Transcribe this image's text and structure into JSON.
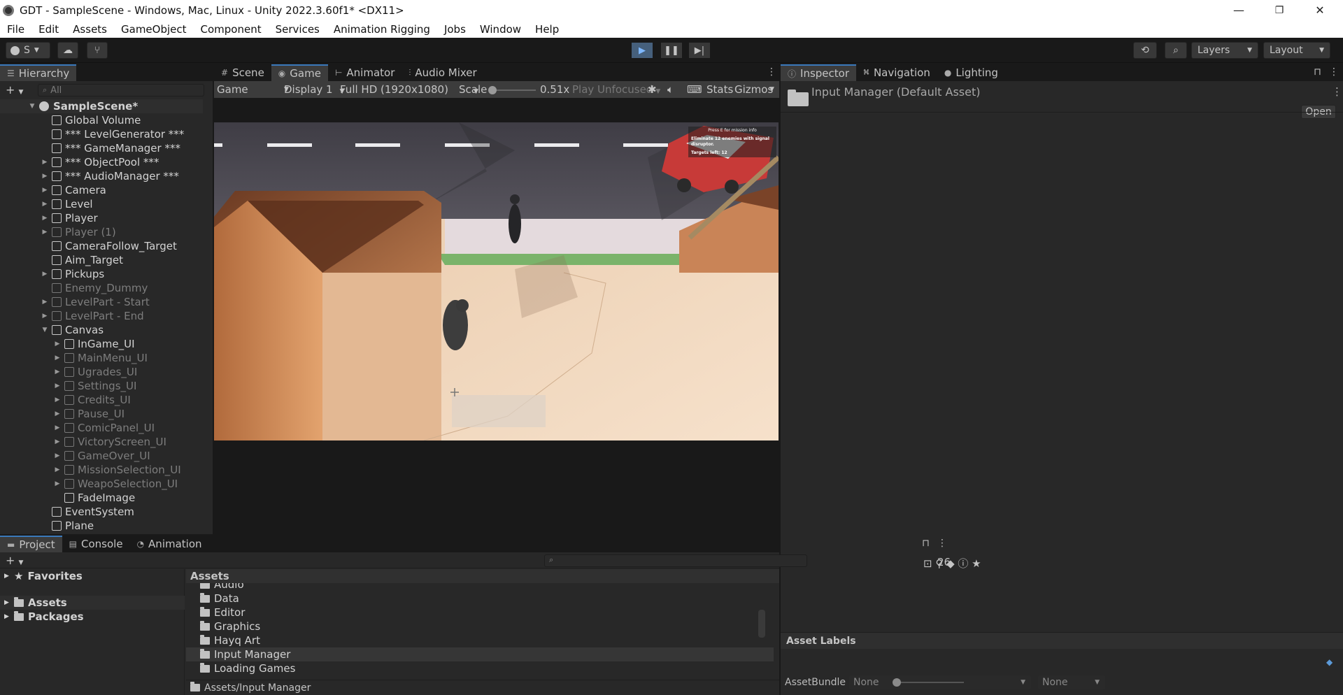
{
  "window": {
    "title": "GDT - SampleScene - Windows, Mac, Linux - Unity 2022.3.60f1* <DX11>",
    "minimize": "—",
    "maximize": "❐",
    "close": "✕"
  },
  "menu": [
    "File",
    "Edit",
    "Assets",
    "GameObject",
    "Component",
    "Services",
    "Animation Rigging",
    "Jobs",
    "Window",
    "Help"
  ],
  "toolbar": {
    "account": "S",
    "layers": "Layers",
    "layout": "Layout"
  },
  "hierarchy": {
    "tab": "Hierarchy",
    "search_placeholder": "All",
    "scene": "SampleScene*",
    "items": [
      {
        "label": "Global Volume",
        "arrow": "",
        "dim": false,
        "indent": 0
      },
      {
        "label": "*** LevelGenerator ***",
        "arrow": "",
        "dim": false,
        "indent": 0
      },
      {
        "label": "*** GameManager ***",
        "arrow": "",
        "dim": false,
        "indent": 0
      },
      {
        "label": "*** ObjectPool ***",
        "arrow": "▶",
        "dim": false,
        "indent": 0
      },
      {
        "label": "*** AudioManager ***",
        "arrow": "▶",
        "dim": false,
        "indent": 0
      },
      {
        "label": "Camera",
        "arrow": "▶",
        "dim": false,
        "indent": 0
      },
      {
        "label": "Level",
        "arrow": "▶",
        "dim": false,
        "indent": 0
      },
      {
        "label": "Player",
        "arrow": "▶",
        "dim": false,
        "indent": 0
      },
      {
        "label": "Player (1)",
        "arrow": "▶",
        "dim": true,
        "indent": 0
      },
      {
        "label": "CameraFollow_Target",
        "arrow": "",
        "dim": false,
        "indent": 0
      },
      {
        "label": "Aim_Target",
        "arrow": "",
        "dim": false,
        "indent": 0
      },
      {
        "label": "Pickups",
        "arrow": "▶",
        "dim": false,
        "indent": 0
      },
      {
        "label": "Enemy_Dummy",
        "arrow": "",
        "dim": true,
        "indent": 0
      },
      {
        "label": "LevelPart - Start",
        "arrow": "▶",
        "dim": true,
        "indent": 0
      },
      {
        "label": "LevelPart - End",
        "arrow": "▶",
        "dim": true,
        "indent": 0
      },
      {
        "label": "Canvas",
        "arrow": "▼",
        "dim": false,
        "indent": 0
      },
      {
        "label": "InGame_UI",
        "arrow": "▶",
        "dim": false,
        "indent": 1
      },
      {
        "label": "MainMenu_UI",
        "arrow": "▶",
        "dim": true,
        "indent": 1
      },
      {
        "label": "Ugrades_UI",
        "arrow": "▶",
        "dim": true,
        "indent": 1
      },
      {
        "label": "Settings_UI",
        "arrow": "▶",
        "dim": true,
        "indent": 1
      },
      {
        "label": "Credits_UI",
        "arrow": "▶",
        "dim": true,
        "indent": 1
      },
      {
        "label": "Pause_UI",
        "arrow": "▶",
        "dim": true,
        "indent": 1
      },
      {
        "label": "ComicPanel_UI",
        "arrow": "▶",
        "dim": true,
        "indent": 1
      },
      {
        "label": "VictoryScreen_UI",
        "arrow": "▶",
        "dim": true,
        "indent": 1
      },
      {
        "label": "GameOver_UI",
        "arrow": "▶",
        "dim": true,
        "indent": 1
      },
      {
        "label": "MissionSelection_UI",
        "arrow": "▶",
        "dim": true,
        "indent": 1
      },
      {
        "label": "WeapoSelection_UI",
        "arrow": "▶",
        "dim": true,
        "indent": 1
      },
      {
        "label": "FadeImage",
        "arrow": "",
        "dim": false,
        "indent": 1
      },
      {
        "label": "EventSystem",
        "arrow": "",
        "dim": false,
        "indent": 0
      },
      {
        "label": "Plane",
        "arrow": "",
        "dim": false,
        "indent": 0
      }
    ]
  },
  "center_tabs": [
    "Scene",
    "Game",
    "Animator",
    "Audio Mixer"
  ],
  "game": {
    "mode": "Game",
    "display": "Display 1",
    "resolution": "Full HD (1920x1080)",
    "scale_label": "Scale",
    "scale_value": "0.51x",
    "play_mode": "Play Unfocused",
    "stats": "Stats",
    "gizmos": "Gizmos",
    "hud_hint": "Press E for mission info",
    "hud_mission": "Eliminate 12 enemies with signal disruptor.",
    "hud_targets": "Targets left: 12"
  },
  "inspector": {
    "tabs": [
      "Inspector",
      "Navigation",
      "Lighting"
    ],
    "asset_title": "Input Manager (Default Asset)",
    "open_button": "Open",
    "asset_labels": "Asset Labels",
    "assetbundle_label": "AssetBundle",
    "assetbundle_value": "None",
    "variant_value": "None"
  },
  "project": {
    "tabs": [
      "Project",
      "Console",
      "Animation"
    ],
    "count": "26",
    "favorites": "Favorites",
    "assets": "Assets",
    "packages": "Packages",
    "assets_header": "Assets",
    "folders": [
      "Audio",
      "Data",
      "Editor",
      "Graphics",
      "Hayq Art",
      "Input Manager",
      "Loading Games"
    ],
    "path": "Assets/Input Manager"
  }
}
